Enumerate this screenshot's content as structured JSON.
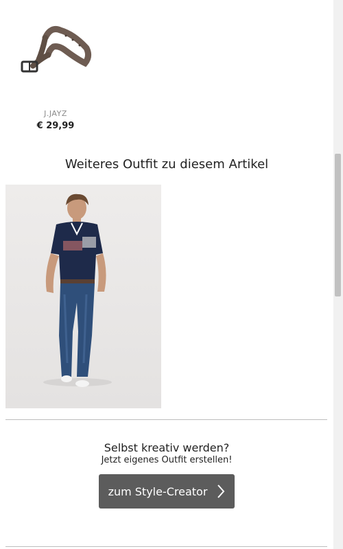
{
  "product": {
    "image_icon": "belt-image",
    "brand": "J.JAYZ",
    "price": "€ 29,99"
  },
  "outfit_section": {
    "title": "Weiteres Outfit zu diesem Artikel",
    "image_icon": "outfit-model-photo"
  },
  "style_creator": {
    "title": "Selbst kreativ werden?",
    "subtitle": "Jetzt eigenes Outfit erstellen!",
    "button_label": "zum Style-Creator",
    "button_icon": "chevron-right-icon",
    "button_color": "#5c5c5c"
  }
}
